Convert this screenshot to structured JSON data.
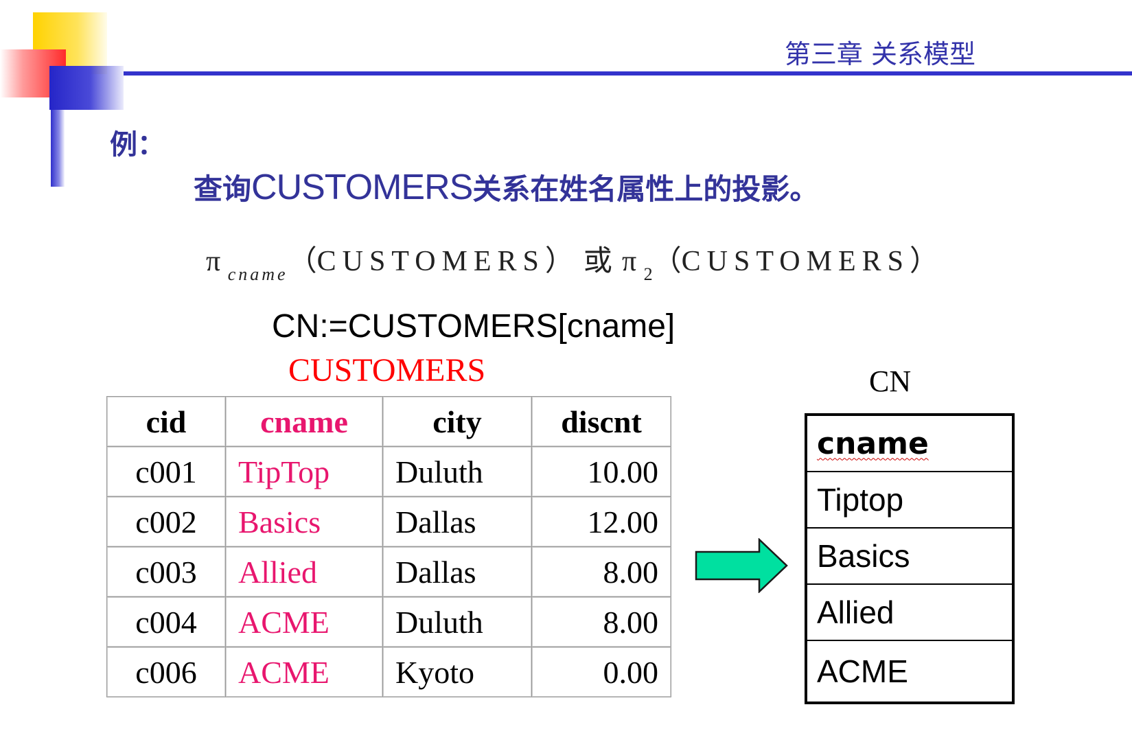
{
  "header": {
    "chapter_title": "第三章 关系模型"
  },
  "example": {
    "label": "例：",
    "query_prefix": "查询",
    "query_relation": "CUSTOMERS",
    "query_suffix": "关系在姓名属性上的投影。"
  },
  "formula": {
    "pi": "π",
    "subscript_name": "cname",
    "open_paren": "（",
    "relation": "CUSTOMERS",
    "close_paren": "）",
    "or_word": "或",
    "subscript_index": "2"
  },
  "assignment": "CN:=CUSTOMERS[cname]",
  "customers_table": {
    "caption": "CUSTOMERS",
    "columns": [
      "cid",
      "cname",
      "city",
      "discnt"
    ],
    "rows": [
      [
        "c001",
        "TipTop",
        "Duluth",
        "10.00"
      ],
      [
        "c002",
        "Basics",
        "Dallas",
        "12.00"
      ],
      [
        "c003",
        "Allied",
        "Dallas",
        "8.00"
      ],
      [
        "c004",
        "ACME",
        "Duluth",
        "8.00"
      ],
      [
        "c006",
        "ACME",
        "Kyoto",
        "0.00"
      ]
    ]
  },
  "cn_table": {
    "caption": "CN",
    "column": "cname",
    "rows": [
      "Tiptop",
      "Basics",
      "Allied",
      "ACME"
    ]
  },
  "colors": {
    "theme_blue": "#3333cc",
    "highlight_pink": "#e8166e",
    "caption_red": "#ff0000",
    "arrow_fill": "#00e0a0"
  },
  "icons": {
    "arrow": "right-arrow-icon"
  }
}
